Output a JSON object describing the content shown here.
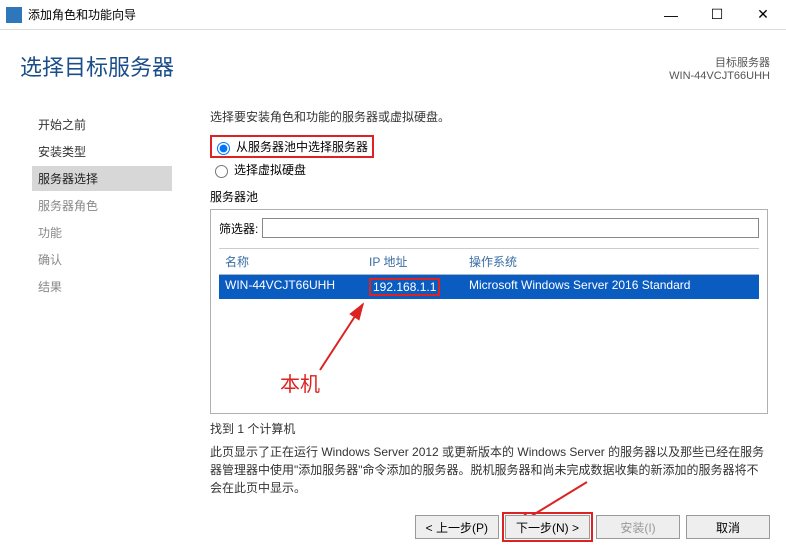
{
  "titlebar": {
    "app_title": "添加角色和功能向导"
  },
  "header": {
    "title": "选择目标服务器"
  },
  "target": {
    "label": "目标服务器",
    "name": "WIN-44VCJT66UHH"
  },
  "sidebar": {
    "items": [
      {
        "label": "开始之前",
        "state": "enabled"
      },
      {
        "label": "安装类型",
        "state": "enabled"
      },
      {
        "label": "服务器选择",
        "state": "active"
      },
      {
        "label": "服务器角色",
        "state": "disabled"
      },
      {
        "label": "功能",
        "state": "disabled"
      },
      {
        "label": "确认",
        "state": "disabled"
      },
      {
        "label": "结果",
        "state": "disabled"
      }
    ]
  },
  "main": {
    "instruction": "选择要安装角色和功能的服务器或虚拟硬盘。",
    "radio": {
      "option_pool": "从服务器池中选择服务器",
      "option_vhd": "选择虚拟硬盘",
      "selected": "pool"
    },
    "pool_label": "服务器池",
    "filter_label": "筛选器:",
    "filter_value": "",
    "columns": {
      "name": "名称",
      "ip": "IP 地址",
      "os": "操作系统"
    },
    "rows": [
      {
        "name": "WIN-44VCJT66UHH",
        "ip": "192.168.1.1",
        "os": "Microsoft Windows Server 2016 Standard"
      }
    ],
    "count": "找到 1 个计算机",
    "note": "此页显示了正在运行 Windows Server 2012 或更新版本的 Windows Server 的服务器以及那些已经在服务器管理器中使用\"添加服务器\"命令添加的服务器。脱机服务器和尚未完成数据收集的新添加的服务器将不会在此页中显示。"
  },
  "buttons": {
    "prev": "< 上一步(P)",
    "next": "下一步(N) >",
    "install": "安装(I)",
    "cancel": "取消"
  },
  "annotations": {
    "local_machine": "本机"
  }
}
